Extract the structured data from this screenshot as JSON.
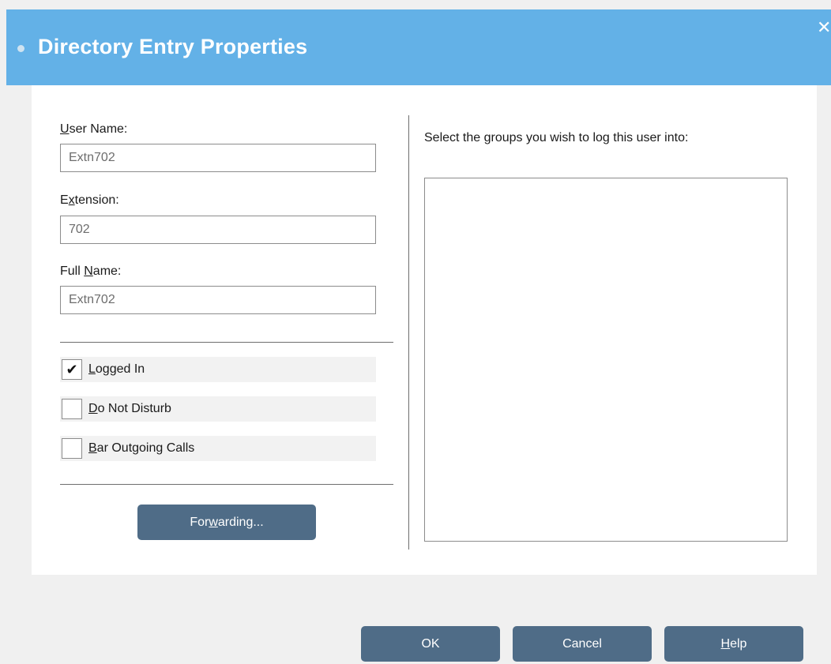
{
  "window": {
    "title": "Directory Entry Properties",
    "close_glyph": "✕"
  },
  "fields": {
    "user_name": {
      "label_prefix": "",
      "label_accel": "U",
      "label_rest": "ser Name:",
      "value": "Extn702"
    },
    "extension": {
      "label_prefix": "E",
      "label_accel": "x",
      "label_rest": "tension:",
      "value": "702"
    },
    "full_name": {
      "label_prefix": "Full ",
      "label_accel": "N",
      "label_rest": "ame:",
      "value": "Extn702"
    }
  },
  "checkboxes": [
    {
      "label_accel": "L",
      "label_rest": "ogged In",
      "checked": true,
      "mark": "✔"
    },
    {
      "label_accel": "D",
      "label_rest": "o Not Disturb",
      "checked": false,
      "mark": ""
    },
    {
      "label_accel": "B",
      "label_rest": "ar Outgoing Calls",
      "checked": false,
      "mark": ""
    }
  ],
  "forwarding_button": {
    "prefix": "For",
    "accel": "w",
    "rest": "arding..."
  },
  "groups": {
    "label_prefix": "Select the ",
    "label_accel": "g",
    "label_rest": "roups you wish to log this user into:",
    "items": []
  },
  "footer": {
    "ok_label": "OK",
    "cancel_label": "Cancel",
    "help_accel": "H",
    "help_rest": "elp"
  },
  "colors": {
    "title_bar": "#63b1e7",
    "button": "#4f6c87",
    "background": "#f0f0f0"
  }
}
